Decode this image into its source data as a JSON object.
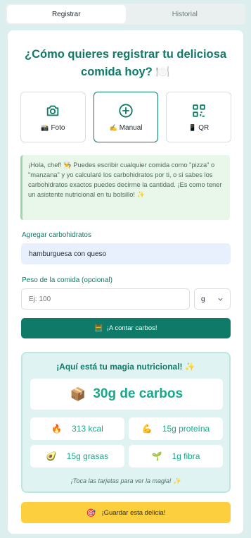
{
  "tabs": [
    {
      "label": "Registrar",
      "active": true
    },
    {
      "label": "Historial",
      "active": false
    }
  ],
  "title": "¿Cómo quieres registrar tu deliciosa comida hoy? 🍽️",
  "methods": [
    {
      "label": "Foto",
      "emoji": "📸",
      "icon": "camera-icon"
    },
    {
      "label": "Manual",
      "emoji": "✍️",
      "icon": "plus-circle-icon"
    },
    {
      "label": "QR",
      "emoji": "📱",
      "icon": "qr-code-icon"
    }
  ],
  "tip": "¡Hola, chef! 👨‍🍳 Puedes escribir cualquier comida como \"pizza\" o \"manzana\" y yo calcularé los carbohidratos por ti, o si sabes los carbohidratos exactos puedes decirme la cantidad. ¡Es como tener un asistente nutricional en tu bolsillo! ✨",
  "carbs_field": {
    "label": "Agregar carbohidratos",
    "value": "hamburguesa con queso"
  },
  "weight_field": {
    "label": "Peso de la comida (opcional)",
    "placeholder": "Ej: 100",
    "unit": "g"
  },
  "count_button": {
    "emoji": "🧮",
    "label": "¡A contar carbos!"
  },
  "result": {
    "title": "¡Aquí está tu magia nutricional! ✨",
    "carbs_emoji": "📦",
    "carbs_text": "30g de carbos",
    "stats": [
      {
        "emoji": "🔥",
        "text": "313 kcal"
      },
      {
        "emoji": "💪",
        "text": "15g proteína"
      },
      {
        "emoji": "🥑",
        "text": "15g grasas"
      },
      {
        "emoji": "🌱",
        "text": "1g fibra"
      }
    ],
    "hint": "¡Toca las tarjetas para ver la magia! ✨"
  },
  "save_button": {
    "emoji": "🎯",
    "label": "¡Guardar esta delicia!"
  },
  "colors": {
    "accent": "#0f7a67",
    "accent_light": "#1aa88a",
    "save": "#fccf3e",
    "background": "#dcefee"
  }
}
